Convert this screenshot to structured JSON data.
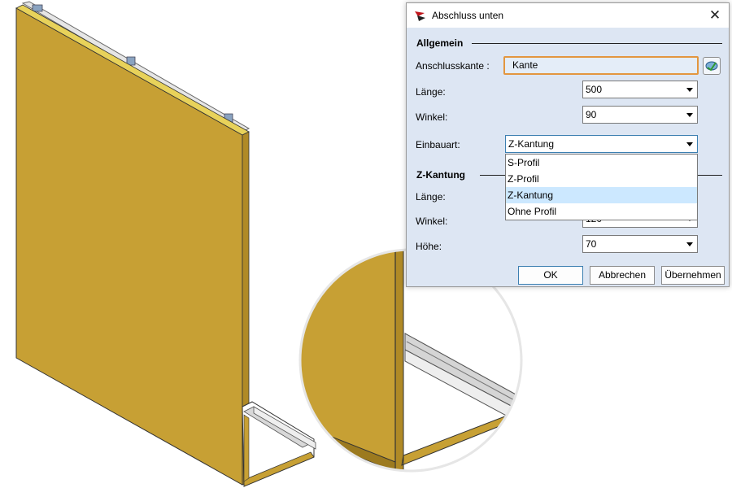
{
  "dialog": {
    "title": "Abschluss unten",
    "close_glyph": "✕",
    "app_icon": "hicad-logo-icon",
    "groups": {
      "allgemein": {
        "title": "Allgemein",
        "anschlusskante_label": "Anschlusskante :",
        "anschlusskante_value": "Kante",
        "pick_icon": "pick-edge-icon",
        "laenge_label": "Länge:",
        "laenge_value": "500",
        "winkel_label": "Winkel:",
        "winkel_value": "90",
        "einbauart_label": "Einbauart:",
        "einbauart_value": "Z-Kantung",
        "einbauart_options": [
          "S-Profil",
          "Z-Profil",
          "Z-Kantung",
          "Ohne Profil"
        ],
        "einbauart_selected_index": 2
      },
      "zkantung": {
        "title": "Z-Kantung",
        "laenge_label": "Länge:",
        "winkel_label": "Winkel:",
        "winkel_value": "120",
        "hoehe_label": "Höhe:",
        "hoehe_value": "70"
      }
    },
    "buttons": {
      "ok": "OK",
      "cancel": "Abbrechen",
      "apply": "Übernehmen"
    },
    "colors": {
      "body_bg": "#dde6f3",
      "field_focus": "#e3963f",
      "dropdown_highlight": "#cce8ff"
    }
  },
  "scene": {
    "panel_color": "#c7a034",
    "panel_edge_color": "#e8d25a",
    "profile_color": "#d8d8d8"
  }
}
